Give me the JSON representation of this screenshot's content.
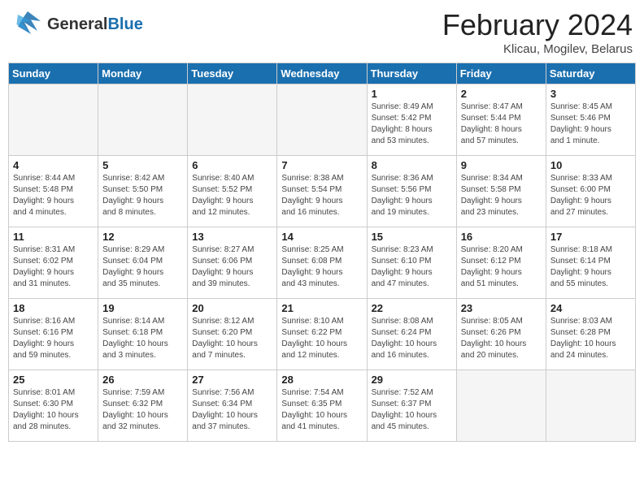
{
  "header": {
    "logo_line1": "General",
    "logo_line2": "Blue",
    "main_title": "February 2024",
    "subtitle": "Klicau, Mogilev, Belarus"
  },
  "days_of_week": [
    "Sunday",
    "Monday",
    "Tuesday",
    "Wednesday",
    "Thursday",
    "Friday",
    "Saturday"
  ],
  "weeks": [
    [
      {
        "day": "",
        "info": ""
      },
      {
        "day": "",
        "info": ""
      },
      {
        "day": "",
        "info": ""
      },
      {
        "day": "",
        "info": ""
      },
      {
        "day": "1",
        "info": "Sunrise: 8:49 AM\nSunset: 5:42 PM\nDaylight: 8 hours\nand 53 minutes."
      },
      {
        "day": "2",
        "info": "Sunrise: 8:47 AM\nSunset: 5:44 PM\nDaylight: 8 hours\nand 57 minutes."
      },
      {
        "day": "3",
        "info": "Sunrise: 8:45 AM\nSunset: 5:46 PM\nDaylight: 9 hours\nand 1 minute."
      }
    ],
    [
      {
        "day": "4",
        "info": "Sunrise: 8:44 AM\nSunset: 5:48 PM\nDaylight: 9 hours\nand 4 minutes."
      },
      {
        "day": "5",
        "info": "Sunrise: 8:42 AM\nSunset: 5:50 PM\nDaylight: 9 hours\nand 8 minutes."
      },
      {
        "day": "6",
        "info": "Sunrise: 8:40 AM\nSunset: 5:52 PM\nDaylight: 9 hours\nand 12 minutes."
      },
      {
        "day": "7",
        "info": "Sunrise: 8:38 AM\nSunset: 5:54 PM\nDaylight: 9 hours\nand 16 minutes."
      },
      {
        "day": "8",
        "info": "Sunrise: 8:36 AM\nSunset: 5:56 PM\nDaylight: 9 hours\nand 19 minutes."
      },
      {
        "day": "9",
        "info": "Sunrise: 8:34 AM\nSunset: 5:58 PM\nDaylight: 9 hours\nand 23 minutes."
      },
      {
        "day": "10",
        "info": "Sunrise: 8:33 AM\nSunset: 6:00 PM\nDaylight: 9 hours\nand 27 minutes."
      }
    ],
    [
      {
        "day": "11",
        "info": "Sunrise: 8:31 AM\nSunset: 6:02 PM\nDaylight: 9 hours\nand 31 minutes."
      },
      {
        "day": "12",
        "info": "Sunrise: 8:29 AM\nSunset: 6:04 PM\nDaylight: 9 hours\nand 35 minutes."
      },
      {
        "day": "13",
        "info": "Sunrise: 8:27 AM\nSunset: 6:06 PM\nDaylight: 9 hours\nand 39 minutes."
      },
      {
        "day": "14",
        "info": "Sunrise: 8:25 AM\nSunset: 6:08 PM\nDaylight: 9 hours\nand 43 minutes."
      },
      {
        "day": "15",
        "info": "Sunrise: 8:23 AM\nSunset: 6:10 PM\nDaylight: 9 hours\nand 47 minutes."
      },
      {
        "day": "16",
        "info": "Sunrise: 8:20 AM\nSunset: 6:12 PM\nDaylight: 9 hours\nand 51 minutes."
      },
      {
        "day": "17",
        "info": "Sunrise: 8:18 AM\nSunset: 6:14 PM\nDaylight: 9 hours\nand 55 minutes."
      }
    ],
    [
      {
        "day": "18",
        "info": "Sunrise: 8:16 AM\nSunset: 6:16 PM\nDaylight: 9 hours\nand 59 minutes."
      },
      {
        "day": "19",
        "info": "Sunrise: 8:14 AM\nSunset: 6:18 PM\nDaylight: 10 hours\nand 3 minutes."
      },
      {
        "day": "20",
        "info": "Sunrise: 8:12 AM\nSunset: 6:20 PM\nDaylight: 10 hours\nand 7 minutes."
      },
      {
        "day": "21",
        "info": "Sunrise: 8:10 AM\nSunset: 6:22 PM\nDaylight: 10 hours\nand 12 minutes."
      },
      {
        "day": "22",
        "info": "Sunrise: 8:08 AM\nSunset: 6:24 PM\nDaylight: 10 hours\nand 16 minutes."
      },
      {
        "day": "23",
        "info": "Sunrise: 8:05 AM\nSunset: 6:26 PM\nDaylight: 10 hours\nand 20 minutes."
      },
      {
        "day": "24",
        "info": "Sunrise: 8:03 AM\nSunset: 6:28 PM\nDaylight: 10 hours\nand 24 minutes."
      }
    ],
    [
      {
        "day": "25",
        "info": "Sunrise: 8:01 AM\nSunset: 6:30 PM\nDaylight: 10 hours\nand 28 minutes."
      },
      {
        "day": "26",
        "info": "Sunrise: 7:59 AM\nSunset: 6:32 PM\nDaylight: 10 hours\nand 32 minutes."
      },
      {
        "day": "27",
        "info": "Sunrise: 7:56 AM\nSunset: 6:34 PM\nDaylight: 10 hours\nand 37 minutes."
      },
      {
        "day": "28",
        "info": "Sunrise: 7:54 AM\nSunset: 6:35 PM\nDaylight: 10 hours\nand 41 minutes."
      },
      {
        "day": "29",
        "info": "Sunrise: 7:52 AM\nSunset: 6:37 PM\nDaylight: 10 hours\nand 45 minutes."
      },
      {
        "day": "",
        "info": ""
      },
      {
        "day": "",
        "info": ""
      }
    ]
  ]
}
